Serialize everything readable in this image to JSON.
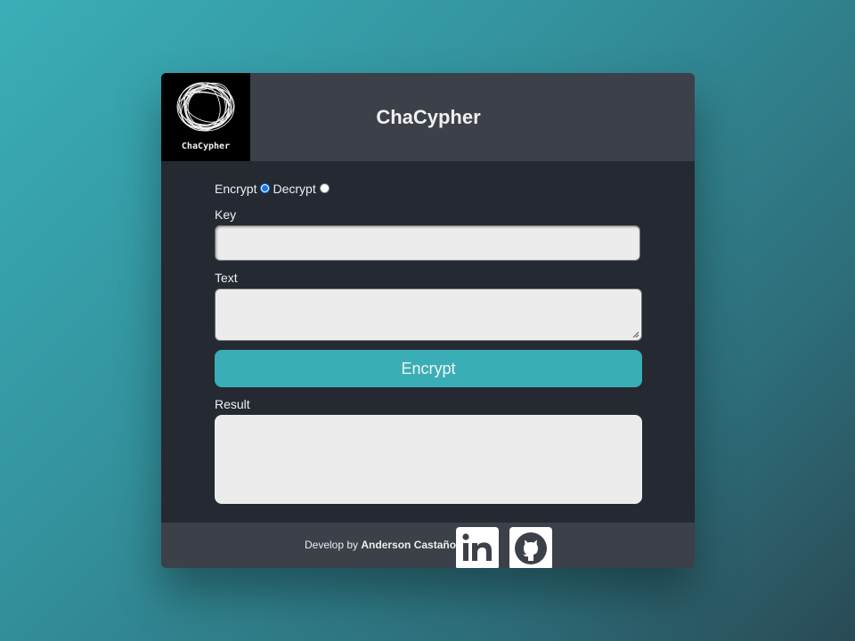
{
  "header": {
    "logo_text": "ChaCypher",
    "title": "ChaCypher"
  },
  "mode": {
    "encrypt_label": "Encrypt",
    "decrypt_label": "Decrypt",
    "selected": "Encrypt"
  },
  "key": {
    "label": "Key",
    "value": ""
  },
  "text": {
    "label": "Text",
    "value": ""
  },
  "action_button_label": "Encrypt",
  "result": {
    "label": "Result",
    "value": ""
  },
  "footer": {
    "credit_prefix": "Develop by ",
    "author": "Anderson Castaño",
    "links": [
      {
        "icon": "linkedin-icon"
      },
      {
        "icon": "github-icon"
      }
    ]
  },
  "colors": {
    "accent": "#3aaeb6",
    "card_background": "#252932",
    "header_background": "#3c4049",
    "field_background": "#ececec"
  }
}
